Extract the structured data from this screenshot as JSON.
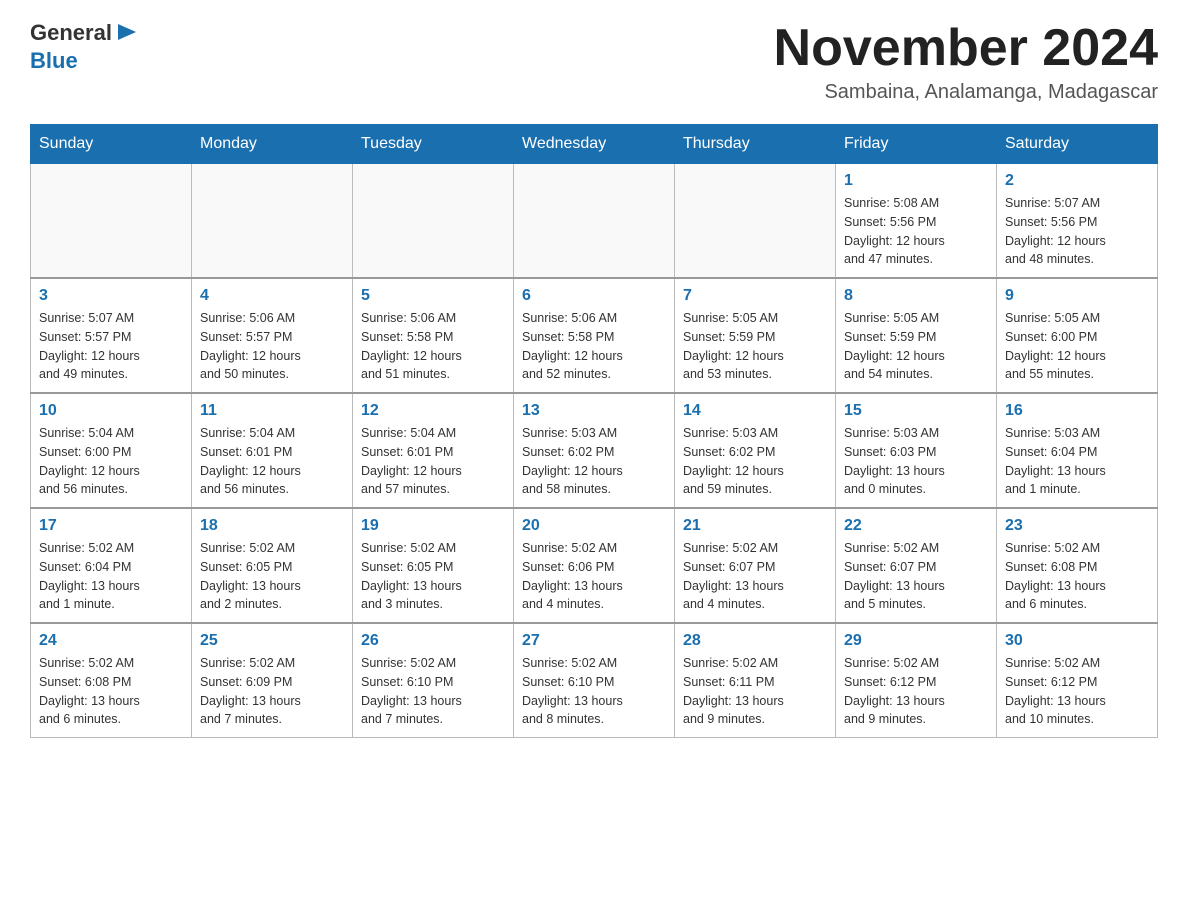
{
  "header": {
    "logo_general": "General",
    "logo_blue": "Blue",
    "month_title": "November 2024",
    "subtitle": "Sambaina, Analamanga, Madagascar"
  },
  "days_of_week": [
    "Sunday",
    "Monday",
    "Tuesday",
    "Wednesday",
    "Thursday",
    "Friday",
    "Saturday"
  ],
  "weeks": [
    {
      "cells": [
        {
          "day": "",
          "info": ""
        },
        {
          "day": "",
          "info": ""
        },
        {
          "day": "",
          "info": ""
        },
        {
          "day": "",
          "info": ""
        },
        {
          "day": "",
          "info": ""
        },
        {
          "day": "1",
          "info": "Sunrise: 5:08 AM\nSunset: 5:56 PM\nDaylight: 12 hours\nand 47 minutes."
        },
        {
          "day": "2",
          "info": "Sunrise: 5:07 AM\nSunset: 5:56 PM\nDaylight: 12 hours\nand 48 minutes."
        }
      ]
    },
    {
      "cells": [
        {
          "day": "3",
          "info": "Sunrise: 5:07 AM\nSunset: 5:57 PM\nDaylight: 12 hours\nand 49 minutes."
        },
        {
          "day": "4",
          "info": "Sunrise: 5:06 AM\nSunset: 5:57 PM\nDaylight: 12 hours\nand 50 minutes."
        },
        {
          "day": "5",
          "info": "Sunrise: 5:06 AM\nSunset: 5:58 PM\nDaylight: 12 hours\nand 51 minutes."
        },
        {
          "day": "6",
          "info": "Sunrise: 5:06 AM\nSunset: 5:58 PM\nDaylight: 12 hours\nand 52 minutes."
        },
        {
          "day": "7",
          "info": "Sunrise: 5:05 AM\nSunset: 5:59 PM\nDaylight: 12 hours\nand 53 minutes."
        },
        {
          "day": "8",
          "info": "Sunrise: 5:05 AM\nSunset: 5:59 PM\nDaylight: 12 hours\nand 54 minutes."
        },
        {
          "day": "9",
          "info": "Sunrise: 5:05 AM\nSunset: 6:00 PM\nDaylight: 12 hours\nand 55 minutes."
        }
      ]
    },
    {
      "cells": [
        {
          "day": "10",
          "info": "Sunrise: 5:04 AM\nSunset: 6:00 PM\nDaylight: 12 hours\nand 56 minutes."
        },
        {
          "day": "11",
          "info": "Sunrise: 5:04 AM\nSunset: 6:01 PM\nDaylight: 12 hours\nand 56 minutes."
        },
        {
          "day": "12",
          "info": "Sunrise: 5:04 AM\nSunset: 6:01 PM\nDaylight: 12 hours\nand 57 minutes."
        },
        {
          "day": "13",
          "info": "Sunrise: 5:03 AM\nSunset: 6:02 PM\nDaylight: 12 hours\nand 58 minutes."
        },
        {
          "day": "14",
          "info": "Sunrise: 5:03 AM\nSunset: 6:02 PM\nDaylight: 12 hours\nand 59 minutes."
        },
        {
          "day": "15",
          "info": "Sunrise: 5:03 AM\nSunset: 6:03 PM\nDaylight: 13 hours\nand 0 minutes."
        },
        {
          "day": "16",
          "info": "Sunrise: 5:03 AM\nSunset: 6:04 PM\nDaylight: 13 hours\nand 1 minute."
        }
      ]
    },
    {
      "cells": [
        {
          "day": "17",
          "info": "Sunrise: 5:02 AM\nSunset: 6:04 PM\nDaylight: 13 hours\nand 1 minute."
        },
        {
          "day": "18",
          "info": "Sunrise: 5:02 AM\nSunset: 6:05 PM\nDaylight: 13 hours\nand 2 minutes."
        },
        {
          "day": "19",
          "info": "Sunrise: 5:02 AM\nSunset: 6:05 PM\nDaylight: 13 hours\nand 3 minutes."
        },
        {
          "day": "20",
          "info": "Sunrise: 5:02 AM\nSunset: 6:06 PM\nDaylight: 13 hours\nand 4 minutes."
        },
        {
          "day": "21",
          "info": "Sunrise: 5:02 AM\nSunset: 6:07 PM\nDaylight: 13 hours\nand 4 minutes."
        },
        {
          "day": "22",
          "info": "Sunrise: 5:02 AM\nSunset: 6:07 PM\nDaylight: 13 hours\nand 5 minutes."
        },
        {
          "day": "23",
          "info": "Sunrise: 5:02 AM\nSunset: 6:08 PM\nDaylight: 13 hours\nand 6 minutes."
        }
      ]
    },
    {
      "cells": [
        {
          "day": "24",
          "info": "Sunrise: 5:02 AM\nSunset: 6:08 PM\nDaylight: 13 hours\nand 6 minutes."
        },
        {
          "day": "25",
          "info": "Sunrise: 5:02 AM\nSunset: 6:09 PM\nDaylight: 13 hours\nand 7 minutes."
        },
        {
          "day": "26",
          "info": "Sunrise: 5:02 AM\nSunset: 6:10 PM\nDaylight: 13 hours\nand 7 minutes."
        },
        {
          "day": "27",
          "info": "Sunrise: 5:02 AM\nSunset: 6:10 PM\nDaylight: 13 hours\nand 8 minutes."
        },
        {
          "day": "28",
          "info": "Sunrise: 5:02 AM\nSunset: 6:11 PM\nDaylight: 13 hours\nand 9 minutes."
        },
        {
          "day": "29",
          "info": "Sunrise: 5:02 AM\nSunset: 6:12 PM\nDaylight: 13 hours\nand 9 minutes."
        },
        {
          "day": "30",
          "info": "Sunrise: 5:02 AM\nSunset: 6:12 PM\nDaylight: 13 hours\nand 10 minutes."
        }
      ]
    }
  ]
}
